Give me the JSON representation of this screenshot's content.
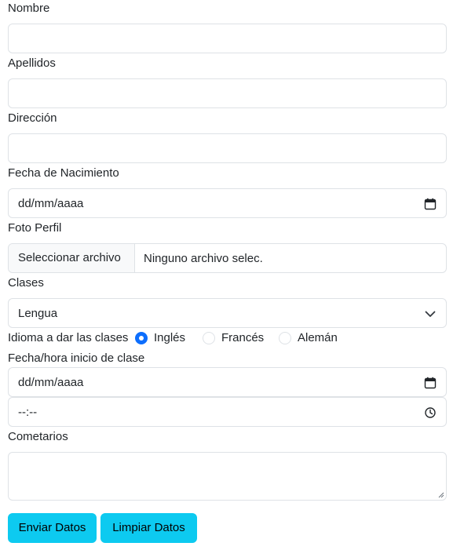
{
  "form": {
    "nombre_label": "Nombre",
    "nombre_value": "",
    "apellidos_label": "Apellidos",
    "apellidos_value": "",
    "direccion_label": "Dirección",
    "direccion_value": "",
    "fecha_nacimiento_label": "Fecha de Nacimiento",
    "fecha_nacimiento_value": "dd/mm/aaaa",
    "foto_label": "Foto Perfil",
    "foto_button": "Seleccionar archivo",
    "foto_status": "Ninguno archivo selec.",
    "clases_label": "Clases",
    "clases_selected": "Lengua",
    "idioma_label": "Idioma a dar las clases",
    "idioma_options": [
      {
        "label": "Inglés",
        "checked": true
      },
      {
        "label": "Francés",
        "checked": false
      },
      {
        "label": "Alemán",
        "checked": false
      }
    ],
    "inicio_label": "Fecha/hora inicio de clase",
    "inicio_fecha_value": "dd/mm/aaaa",
    "inicio_hora_value": "--:--",
    "comentarios_label": "Cometarios",
    "comentarios_value": ""
  },
  "buttons": {
    "enviar": "Enviar Datos",
    "limpiar": "Limpiar Datos"
  },
  "colors": {
    "button_bg": "#0dcaf0",
    "radio_checked": "#0d6efd",
    "border": "#dee2e6"
  },
  "icons": {
    "date": "calendar-icon",
    "time": "clock-icon",
    "select": "chevron-down-icon"
  }
}
